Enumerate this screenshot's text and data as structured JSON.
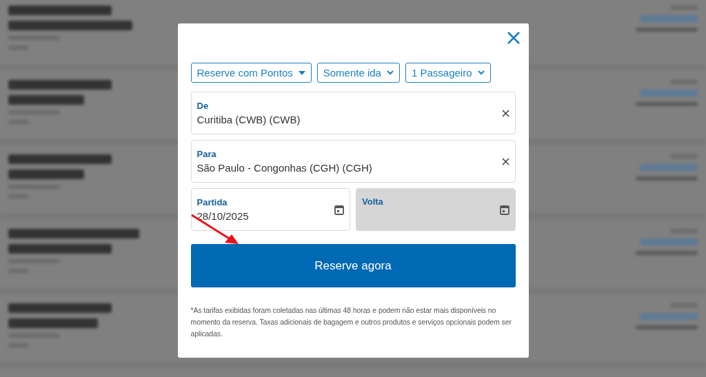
{
  "modal": {
    "filters": [
      {
        "label": "Reserve com Pontos",
        "kind": "caret"
      },
      {
        "label": "Somente ida",
        "kind": "chevron"
      },
      {
        "label": "1 Passageiro",
        "kind": "chevron"
      }
    ],
    "locations": [
      {
        "label": "De",
        "value": "Curitiba (CWB) (CWB)"
      },
      {
        "label": "Para",
        "value": "São Paulo - Congonhas (CGH) (CGH)"
      }
    ],
    "dates": [
      {
        "label": "Partida",
        "value": "28/10/2025",
        "disabled": false
      },
      {
        "label": "Volta",
        "disabled": true
      }
    ],
    "submit": "Reserve agora",
    "disclaimer": "*As tarifas exibidas foram coletadas nas últimas 48 horas e podem não estar mais disponíveis no momento da reserva. Taxas adicionais de bagagem e outros produtos e serviços opcionais podem ser aplicadas."
  }
}
